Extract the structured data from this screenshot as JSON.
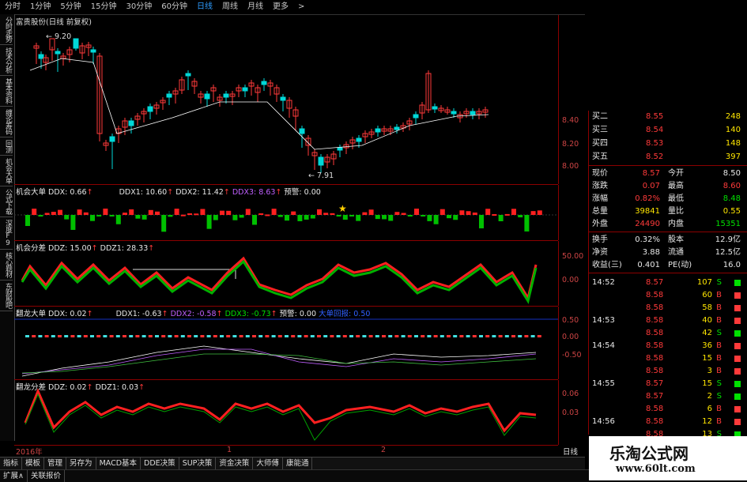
{
  "period_bar": {
    "items": [
      "分时",
      "1分钟",
      "5分钟",
      "15分钟",
      "30分钟",
      "60分钟",
      "日线",
      "周线",
      "月线",
      "更多"
    ],
    "active": "日线",
    "more_arrow": ">"
  },
  "side_tabs": [
    "分时走势",
    "技术分析",
    "基本资料",
    "缠论筹码",
    "回测",
    "机会大单",
    "公式下载",
    "深度F9",
    "核心题材",
    "东财股吧"
  ],
  "main_chart": {
    "title": "富贵股份(日线 前复权)",
    "high_label": "9.20",
    "low_label": "7.91",
    "axis": [
      "8.40",
      "8.20",
      "8.00"
    ]
  },
  "panel1": {
    "name": "机会大单",
    "ddx_label": "DDX:",
    "ddx": "0.66",
    "ddx1_label": "DDX1:",
    "ddx1": "10.60",
    "ddx2_label": "DDX2:",
    "ddx2": "11.42",
    "ddx3_label": "DDX3:",
    "ddx3": "8.63",
    "warn_label": "预警:",
    "warn": "0.00",
    "arrow": "↑"
  },
  "panel2": {
    "name": "机会分差",
    "ddz_label": "DDZ:",
    "ddz": "15.00",
    "ddz1_label": "DDZ1:",
    "ddz1": "28.33",
    "axis": [
      "50.00",
      "0.00"
    ]
  },
  "panel3": {
    "name": "翻龙大单",
    "ddx_label": "DDX:",
    "ddx": "0.02",
    "ddx1_label": "DDX1:",
    "ddx1": "-0.63",
    "ddx2_label": "DDX2:",
    "ddx2": "-0.58",
    "ddx3_label": "DDX3:",
    "ddx3": "-0.73",
    "warn_label": "预警:",
    "warn": "0.00",
    "extra": "大单回报: 0.50",
    "axis": [
      "0.50",
      "0.00",
      "-0.50"
    ]
  },
  "panel4": {
    "name": "翻龙分差",
    "ddz_label": "DDZ:",
    "ddz": "0.02",
    "ddz1_label": "DDZ1:",
    "ddz1": "0.03",
    "axis": [
      "0.06",
      "0.03"
    ]
  },
  "x_axis": {
    "start": "2016年",
    "mark1": "1",
    "mark2": "2",
    "period": "日线"
  },
  "quote": {
    "asks": [
      {
        "label": "买二",
        "price": "8.55",
        "vol": "248"
      },
      {
        "label": "买三",
        "price": "8.54",
        "vol": "140"
      },
      {
        "label": "买四",
        "price": "8.53",
        "vol": "148"
      },
      {
        "label": "买五",
        "price": "8.52",
        "vol": "397"
      }
    ],
    "stats": [
      {
        "l1": "现价",
        "v1": "8.57",
        "l2": "今开",
        "v2": "8.50",
        "c1": "red",
        "c2": "white"
      },
      {
        "l1": "涨跌",
        "v1": "0.07",
        "l2": "最高",
        "v2": "8.60",
        "c1": "red",
        "c2": "red"
      },
      {
        "l1": "涨幅",
        "v1": "0.82%",
        "l2": "最低",
        "v2": "8.48",
        "c1": "red",
        "c2": "green"
      },
      {
        "l1": "总量",
        "v1": "39841",
        "l2": "量比",
        "v2": "0.55",
        "c1": "yellow",
        "c2": "yellow"
      },
      {
        "l1": "外盘",
        "v1": "24490",
        "l2": "内盘",
        "v2": "15351",
        "c1": "red",
        "c2": "green"
      },
      {
        "l1": "换手",
        "v1": "0.32%",
        "l2": "股本",
        "v2": "12.9亿",
        "c1": "white",
        "c2": "white"
      },
      {
        "l1": "净资",
        "v1": "3.88",
        "l2": "流通",
        "v2": "12.5亿",
        "c1": "white",
        "c2": "white"
      },
      {
        "l1": "收益(三)",
        "v1": "0.401",
        "l2": "PE(动)",
        "v2": "16.0",
        "c1": "white",
        "c2": "white"
      }
    ],
    "ticks": [
      {
        "time": "14:52",
        "price": "8.57",
        "vol": "107",
        "side": "S"
      },
      {
        "time": "",
        "price": "8.58",
        "vol": "60",
        "side": "B"
      },
      {
        "time": "",
        "price": "8.58",
        "vol": "58",
        "side": "B"
      },
      {
        "time": "14:53",
        "price": "8.58",
        "vol": "40",
        "side": "B"
      },
      {
        "time": "",
        "price": "8.58",
        "vol": "42",
        "side": "S"
      },
      {
        "time": "14:54",
        "price": "8.58",
        "vol": "36",
        "side": "B"
      },
      {
        "time": "",
        "price": "8.58",
        "vol": "15",
        "side": "B"
      },
      {
        "time": "",
        "price": "8.58",
        "vol": "3",
        "side": "B"
      },
      {
        "time": "14:55",
        "price": "8.57",
        "vol": "15",
        "side": "S"
      },
      {
        "time": "",
        "price": "8.57",
        "vol": "2",
        "side": "S"
      },
      {
        "time": "",
        "price": "8.58",
        "vol": "6",
        "side": "B"
      },
      {
        "time": "14:56",
        "price": "8.58",
        "vol": "12",
        "side": "B"
      },
      {
        "time": "",
        "price": "8.58",
        "vol": "13",
        "side": "S"
      }
    ]
  },
  "bottom_tabs": [
    "指标",
    "模板",
    "管理",
    "另存为",
    "MACD基本",
    "DDE决策",
    "SUP决策",
    "资金决策",
    "大师傅",
    "康能通"
  ],
  "status_tabs": [
    "扩展∧",
    "关联报价"
  ],
  "watermark": {
    "title": "乐淘公式网",
    "url": "www.60lt.com"
  },
  "colors": {
    "up": "#ff3a3a",
    "down": "#00d8d8",
    "bg": "#000000",
    "grid": "#8b0000"
  }
}
